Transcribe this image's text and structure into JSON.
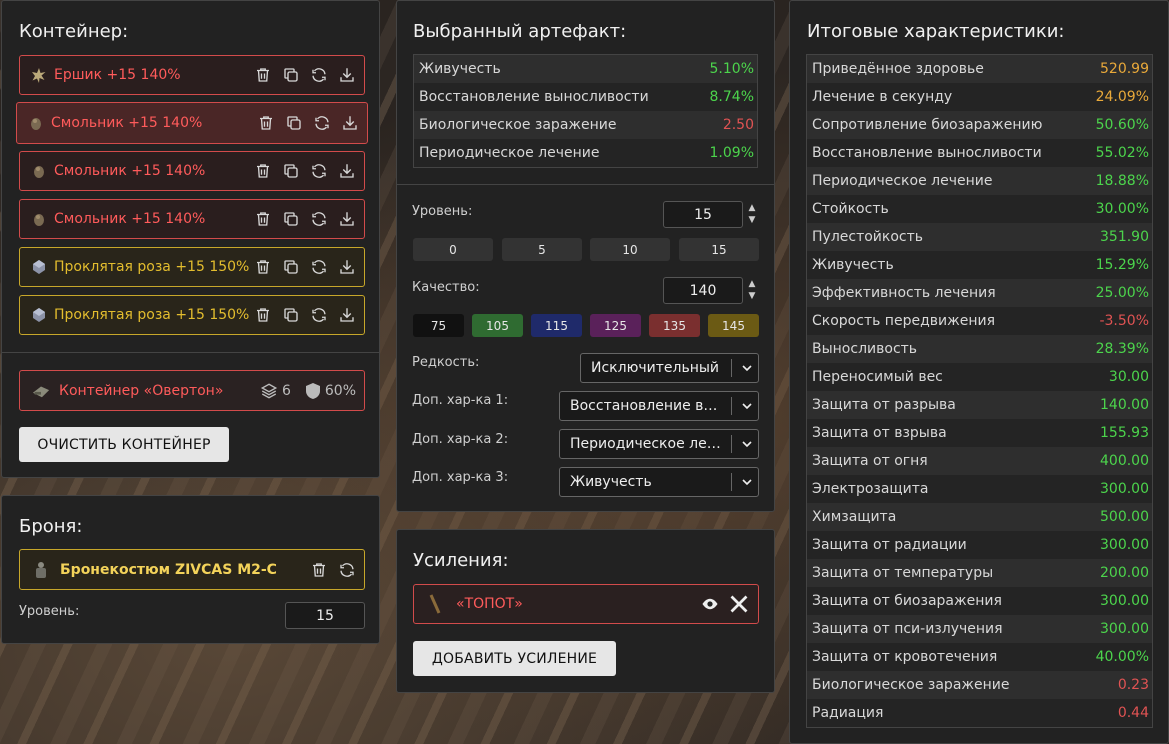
{
  "container": {
    "title": "Контейнер:",
    "items": [
      {
        "label": "Ершик +15 140%",
        "icon": "star-artifact-icon"
      },
      {
        "label": "Смольник +15 140%",
        "icon": "lump-artifact-icon"
      },
      {
        "label": "Смольник +15 140%",
        "icon": "lump-artifact-icon"
      },
      {
        "label": "Смольник +15 140%",
        "icon": "lump-artifact-icon"
      },
      {
        "label": "Проклятая роза +15 150%",
        "icon": "crystal-artifact-icon"
      },
      {
        "label": "Проклятая роза +15 150%",
        "icon": "crystal-artifact-icon"
      }
    ],
    "box": {
      "label": "Контейнер «Овертон»",
      "slots": "6",
      "protection": "60%"
    },
    "clear_button": "ОЧИСТИТЬ КОНТЕЙНЕР"
  },
  "armor": {
    "title": "Броня:",
    "item": "Бронекостюм ZIVCAS M2-C",
    "level_label": "Уровень:",
    "level_value": "15"
  },
  "artifact": {
    "title": "Выбранный артефакт:",
    "stats": [
      {
        "name": "Живучесть",
        "value": "5.10%",
        "color": "green"
      },
      {
        "name": "Восстановление выносливости",
        "value": "8.74%",
        "color": "green"
      },
      {
        "name": "Биологическое заражение",
        "value": "2.50",
        "color": "red"
      },
      {
        "name": "Периодическое лечение",
        "value": "1.09%",
        "color": "green"
      }
    ],
    "level_label": "Уровень:",
    "level_value": "15",
    "level_presets": [
      "0",
      "5",
      "10",
      "15"
    ],
    "quality_label": "Качество:",
    "quality_value": "140",
    "quality_presets": [
      {
        "value": "75",
        "color": "#111111"
      },
      {
        "value": "105",
        "color": "#2f6b31"
      },
      {
        "value": "115",
        "color": "#1f2a6a"
      },
      {
        "value": "125",
        "color": "#5a215a"
      },
      {
        "value": "135",
        "color": "#7a2f2f"
      },
      {
        "value": "145",
        "color": "#6b5a14"
      }
    ],
    "rarity_label": "Редкость:",
    "rarity_value": "Исключительный",
    "extra1_label": "Доп. хар-ка 1:",
    "extra1_value": "Восстановление выносливости",
    "extra2_label": "Доп. хар-ка 2:",
    "extra2_value": "Периодическое лечение",
    "extra3_label": "Доп. хар-ка 3:",
    "extra3_value": "Живучесть"
  },
  "boosts": {
    "title": "Усиления:",
    "item": "«ТОПОТ»",
    "add_button": "ДОБАВИТЬ УСИЛЕНИЕ"
  },
  "totals": {
    "title": "Итоговые характеристики:",
    "stats": [
      {
        "name": "Приведённое здоровье",
        "value": "520.99",
        "color": "orange"
      },
      {
        "name": "Лечение в секунду",
        "value": "24.09%",
        "color": "orange"
      },
      {
        "name": "Сопротивление биозаражению",
        "value": "50.60%",
        "color": "green"
      },
      {
        "name": "Восстановление выносливости",
        "value": "55.02%",
        "color": "green"
      },
      {
        "name": "Периодическое лечение",
        "value": "18.88%",
        "color": "green"
      },
      {
        "name": "Стойкость",
        "value": "30.00%",
        "color": "green"
      },
      {
        "name": "Пулестойкость",
        "value": "351.90",
        "color": "green"
      },
      {
        "name": "Живучесть",
        "value": "15.29%",
        "color": "green"
      },
      {
        "name": "Эффективность лечения",
        "value": "25.00%",
        "color": "green"
      },
      {
        "name": "Скорость передвижения",
        "value": "-3.50%",
        "color": "red"
      },
      {
        "name": "Выносливость",
        "value": "28.39%",
        "color": "green"
      },
      {
        "name": "Переносимый вес",
        "value": "30.00",
        "color": "green"
      },
      {
        "name": "Защита от разрыва",
        "value": "140.00",
        "color": "green"
      },
      {
        "name": "Защита от взрыва",
        "value": "155.93",
        "color": "green"
      },
      {
        "name": "Защита от огня",
        "value": "400.00",
        "color": "green"
      },
      {
        "name": "Электрозащита",
        "value": "300.00",
        "color": "green"
      },
      {
        "name": "Химзащита",
        "value": "500.00",
        "color": "green"
      },
      {
        "name": "Защита от радиации",
        "value": "300.00",
        "color": "green"
      },
      {
        "name": "Защита от температуры",
        "value": "200.00",
        "color": "green"
      },
      {
        "name": "Защита от биозаражения",
        "value": "300.00",
        "color": "green"
      },
      {
        "name": "Защита от пси-излучения",
        "value": "300.00",
        "color": "green"
      },
      {
        "name": "Защита от кровотечения",
        "value": "40.00%",
        "color": "green"
      },
      {
        "name": "Биологическое заражение",
        "value": "0.23",
        "color": "red"
      },
      {
        "name": "Радиация",
        "value": "0.44",
        "color": "red"
      }
    ]
  },
  "colors": {
    "accent_red": "#d24b4b",
    "accent_yellow": "#c7a72a",
    "positive": "#4cd44c",
    "negative": "#e05353",
    "highlight": "#e9a93a"
  }
}
